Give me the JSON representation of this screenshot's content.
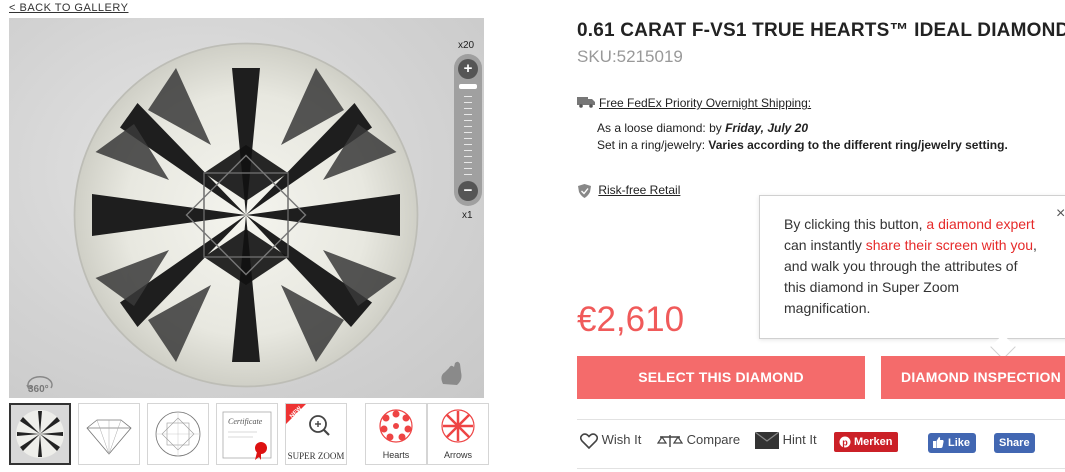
{
  "nav": {
    "back_label": "< BACK TO GALLERY"
  },
  "viewer": {
    "zoom_max_label": "x20",
    "zoom_min_label": "x1",
    "zoom_plus": "+",
    "zoom_minus": "−",
    "rotate_label": "360°",
    "zoom_level_fraction": 0.95
  },
  "thumbnails": [
    {
      "name": "thumb-diamond-photo",
      "label": "",
      "icon": "diamond-photo-icon",
      "active": true
    },
    {
      "name": "thumb-side-profile",
      "label": "",
      "icon": "diamond-profile-icon",
      "active": false
    },
    {
      "name": "thumb-top-diagram",
      "label": "",
      "icon": "diamond-top-diagram-icon",
      "active": false
    },
    {
      "name": "thumb-certificate",
      "label": "",
      "icon": "certificate-icon",
      "active": false
    },
    {
      "name": "thumb-super-zoom",
      "label": "SUPER ZOOM",
      "badge": "NEW",
      "icon": "magnifier-icon",
      "active": false
    },
    {
      "name": "thumb-hearts",
      "label": "Hearts",
      "icon": "hearts-pattern-icon",
      "active": false
    },
    {
      "name": "thumb-arrows",
      "label": "Arrows",
      "icon": "arrows-pattern-icon",
      "active": false
    }
  ],
  "product": {
    "title": "0.61 CARAT F-VS1 TRUE HEARTS™ IDEAL DIAMOND",
    "sku": "SKU:5215019",
    "price": "€2,610"
  },
  "shipping": {
    "link": "Free FedEx Priority Overnight Shipping:",
    "loose_prefix": "As a loose diamond: by ",
    "loose_date": "Friday, July 20",
    "setting_prefix": "Set in a ring/jewelry: ",
    "setting_value": "Varies according to the different ring/jewelry setting."
  },
  "risk": {
    "link": "Risk-free Retail"
  },
  "tooltip": {
    "t1": "By clicking this button, ",
    "h1": "a diamond expert",
    "t2": "can instantly ",
    "h2": "share their screen with you",
    "t3": ",",
    "t4": "and walk you through the attributes of",
    "t5": "this diamond in Super Zoom",
    "t6": "magnification.",
    "close": "×"
  },
  "buttons": {
    "select": "SELECT THIS DIAMOND",
    "inspect": "DIAMOND INSPECTION"
  },
  "actions": {
    "wish": "Wish It",
    "compare": "Compare",
    "hint": "Hint It",
    "pinterest": "Merken",
    "fb_like": "Like 0",
    "fb_share": "Share"
  },
  "colors": {
    "accent": "#f46b6b",
    "price": "#f05a5a",
    "highlight": "#e62a2a",
    "pinterest": "#cb2027",
    "facebook": "#4267b2"
  }
}
